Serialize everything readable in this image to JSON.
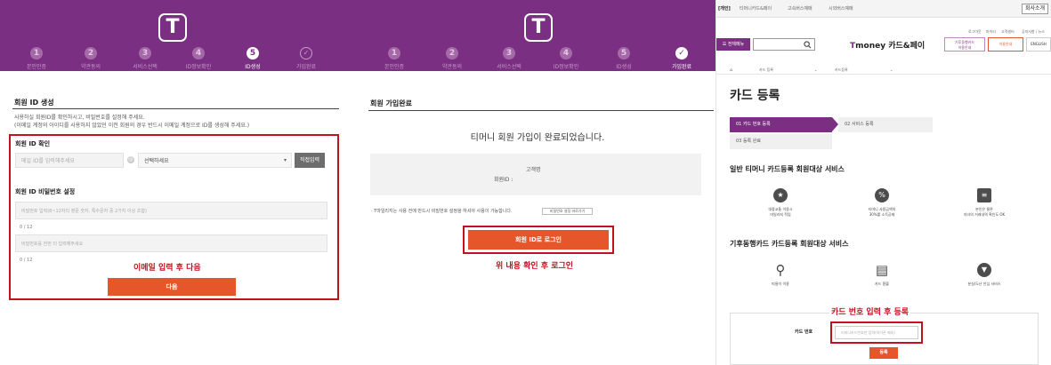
{
  "left_panel": {
    "logo": "T",
    "steps": [
      {
        "num": "1",
        "label": "본인인증"
      },
      {
        "num": "2",
        "label": "약관동의"
      },
      {
        "num": "3",
        "label": "서비스선택"
      },
      {
        "num": "4",
        "label": "ID정보확인"
      },
      {
        "num": "5",
        "label": "ID생성"
      },
      {
        "num": "✓",
        "label": "가입완료"
      }
    ],
    "title": "회원 ID 생성",
    "desc_line1": "사용하실 회원ID를 확인하시고, 비밀번호를 설정해 주세요.",
    "desc_line2": "(이메일 계정의 아이디를 사용하지 않았던 이전 회원의 경우 반드시 이메일 계정으로 ID를 생성해 주세요.)",
    "id_check_label": "회원 ID 확인",
    "email_placeholder": "메일 ID를 입력해주세요",
    "at_symbol": "@",
    "domain_select": "선택하세요",
    "domain_arrow": "▾",
    "direct_input_button": "직접입력",
    "pw_label": "회원 ID 비밀번호 설정",
    "pw_placeholder": "비밀번호 입력(8~12자리 영문 숫자, 특수문자 중 2가지 이상 조합)",
    "pw_count": "0 / 12",
    "pw_confirm_placeholder": "비밀번호를 한번 더 입력해주세요",
    "pw_confirm_count": "0 / 12",
    "annotation": "이메일 입력 후 다음",
    "next_button": "다음"
  },
  "middle_panel": {
    "logo": "T",
    "steps": [
      {
        "num": "1",
        "label": "본인인증"
      },
      {
        "num": "2",
        "label": "약관동의"
      },
      {
        "num": "3",
        "label": "서비스선택"
      },
      {
        "num": "4",
        "label": "ID정보확인"
      },
      {
        "num": "5",
        "label": "ID생성"
      },
      {
        "num": "✓",
        "label": "가입완료"
      }
    ],
    "title": "회원 가입완료",
    "headline": "티머니 회원 가입이 완료되었습니다.",
    "customer_name_label": "고객명",
    "member_id_label": "회원ID :",
    "notice": "· T마일리지는 사용 전에 반드시 비밀번호 설정을 하셔야 사용이 가능합니다.",
    "pw_setting_button": "비밀번호 설정 바로가기",
    "login_button": "회원 ID로 로그인",
    "annotation": "위 내용 확인 후 로그인"
  },
  "right_panel": {
    "top_links": [
      "[개인]",
      "티머니카드&페이",
      "고속버스예매",
      "시외버스예매"
    ],
    "corp_button": "회사소개",
    "util_links": [
      "로그아웃",
      "마이티",
      "고객센터",
      "공지사항 / 뉴스"
    ],
    "menu_button": "☰ 전체메뉴",
    "brand_T": "T",
    "brand_rest": "money 카드&페이",
    "pill_1_line1": "기후동행카드",
    "pill_1_line2": "이용안내",
    "pill_2": "이용안내",
    "pill_3": "ENGLISH",
    "crumb_home": "⌂",
    "crumb_1": "카드 등록",
    "crumb_2": "카드등록",
    "page_title": "카드 등록",
    "step_1": "01 카드 번호 등록",
    "step_2": "02 서비스 등록",
    "step_3": "03 등록 완료",
    "section_1_title": "일반 티머니 카드등록 회원대상 서비스",
    "section_1_items": [
      {
        "icon": "★",
        "line1": "대중교통 이용시",
        "line2": "마일리지 적립"
      },
      {
        "icon": "%",
        "line1": "티머니 사용금액의",
        "line2": "30%를 소득공제"
      },
      {
        "icon": "≡",
        "line1": "본인은 물론",
        "line2": "자녀의 거래내역 확인도 OK"
      }
    ],
    "section_2_title": "기후동행카드 카드등록 회원대상 서비스",
    "section_2_items": [
      {
        "icon": "⚲",
        "line1": "따릉이 이용",
        "line2": ""
      },
      {
        "icon": "▤",
        "line1": "카드 환불",
        "line2": ""
      },
      {
        "icon": "▼",
        "line1": "분실/도난 안심 서비스",
        "line2": ""
      }
    ],
    "annotation": "카드 번호 입력 후 등록",
    "card_number_label": "카드 번호",
    "card_number_placeholder": "티머니카드번호만 입력(하이픈 제외)",
    "register_button": "등록"
  },
  "colors": {
    "brand_purple": "#7b2f83",
    "accent_orange": "#e5572a",
    "annotation_red": "#c1121f"
  }
}
